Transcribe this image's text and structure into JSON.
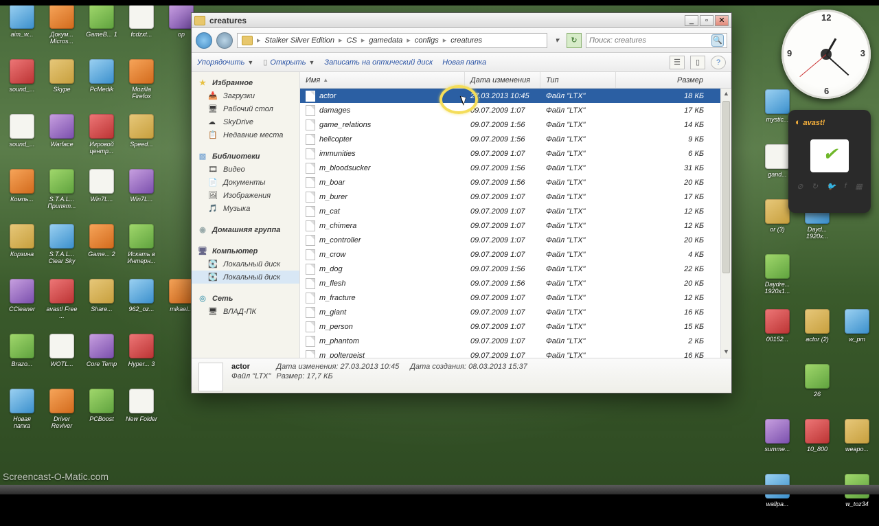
{
  "window": {
    "title": "creatures",
    "breadcrumbs": [
      "Stalker Silver Edition",
      "CS",
      "gamedata",
      "configs",
      "creatures"
    ],
    "search_placeholder": "Поиск: creatures",
    "toolbar": {
      "organize": "Упорядочить",
      "open": "Открыть",
      "burn": "Записать на оптический диск",
      "newfolder": "Новая папка"
    },
    "columns": {
      "name": "Имя",
      "date": "Дата изменения",
      "type": "Тип",
      "size": "Размер"
    },
    "files": [
      {
        "name": "actor",
        "date": "27.03.2013 10:45",
        "type": "Файл \"LTX\"",
        "size": "18 КБ",
        "sel": true
      },
      {
        "name": "damages",
        "date": "09.07.2009 1:07",
        "type": "Файл \"LTX\"",
        "size": "17 КБ"
      },
      {
        "name": "game_relations",
        "date": "09.07.2009 1:56",
        "type": "Файл \"LTX\"",
        "size": "14 КБ"
      },
      {
        "name": "helicopter",
        "date": "09.07.2009 1:56",
        "type": "Файл \"LTX\"",
        "size": "9 КБ"
      },
      {
        "name": "immunities",
        "date": "09.07.2009 1:07",
        "type": "Файл \"LTX\"",
        "size": "6 КБ"
      },
      {
        "name": "m_bloodsucker",
        "date": "09.07.2009 1:56",
        "type": "Файл \"LTX\"",
        "size": "31 КБ"
      },
      {
        "name": "m_boar",
        "date": "09.07.2009 1:56",
        "type": "Файл \"LTX\"",
        "size": "20 КБ"
      },
      {
        "name": "m_burer",
        "date": "09.07.2009 1:07",
        "type": "Файл \"LTX\"",
        "size": "17 КБ"
      },
      {
        "name": "m_cat",
        "date": "09.07.2009 1:07",
        "type": "Файл \"LTX\"",
        "size": "12 КБ"
      },
      {
        "name": "m_chimera",
        "date": "09.07.2009 1:07",
        "type": "Файл \"LTX\"",
        "size": "12 КБ"
      },
      {
        "name": "m_controller",
        "date": "09.07.2009 1:07",
        "type": "Файл \"LTX\"",
        "size": "20 КБ"
      },
      {
        "name": "m_crow",
        "date": "09.07.2009 1:07",
        "type": "Файл \"LTX\"",
        "size": "4 КБ"
      },
      {
        "name": "m_dog",
        "date": "09.07.2009 1:56",
        "type": "Файл \"LTX\"",
        "size": "22 КБ"
      },
      {
        "name": "m_flesh",
        "date": "09.07.2009 1:56",
        "type": "Файл \"LTX\"",
        "size": "20 КБ"
      },
      {
        "name": "m_fracture",
        "date": "09.07.2009 1:07",
        "type": "Файл \"LTX\"",
        "size": "12 КБ"
      },
      {
        "name": "m_giant",
        "date": "09.07.2009 1:07",
        "type": "Файл \"LTX\"",
        "size": "16 КБ"
      },
      {
        "name": "m_person",
        "date": "09.07.2009 1:07",
        "type": "Файл \"LTX\"",
        "size": "15 КБ"
      },
      {
        "name": "m_phantom",
        "date": "09.07.2009 1:07",
        "type": "Файл \"LTX\"",
        "size": "2 КБ"
      },
      {
        "name": "m_poltergeist",
        "date": "09.07.2009 1:07",
        "type": "Файл \"LTX\"",
        "size": "16 КБ"
      }
    ],
    "details": {
      "name": "actor",
      "type": "Файл \"LTX\"",
      "label_modified": "Дата изменения:",
      "modified": "27.03.2013 10:45",
      "label_size": "Размер:",
      "size": "17,7 КБ",
      "label_created": "Дата создания:",
      "created": "08.03.2013 15:37"
    },
    "sidebar": {
      "favorites": {
        "label": "Избранное",
        "items": [
          "Загрузки",
          "Рабочий стол",
          "SkyDrive",
          "Недавние места"
        ]
      },
      "libraries": {
        "label": "Библиотеки",
        "items": [
          "Видео",
          "Документы",
          "Изображения",
          "Музыка"
        ]
      },
      "homegroup": {
        "label": "Домашняя группа"
      },
      "computer": {
        "label": "Компьютер",
        "items": [
          "Локальный диск",
          "Локальный диск"
        ]
      },
      "network": {
        "label": "Сеть",
        "items": [
          "ВЛАД-ПК"
        ]
      }
    }
  },
  "avast": {
    "brand": "avast!"
  },
  "watermark": "Screencast-O-Matic.com",
  "desktop_left": [
    "aim_w...",
    "Докум... Micros...",
    "GameB... 1",
    "fcdzxt...",
    "ор",
    "sound_...",
    "Skype",
    "PcMedik",
    "Mozilla Firefox",
    "",
    "sound_...",
    "Warface",
    "Игровой центр...",
    "Speed...",
    "",
    "Компь...",
    "S.T.A.L... Припят...",
    "Win7L...",
    "Win7L...",
    "",
    "Корзина",
    "S.T.A.L... Clear Sky",
    "Game... 2",
    "Искать в Интерн...",
    "",
    "CCleaner",
    "avast! Free ...",
    "Share...",
    "962_oz...",
    "mikael...",
    "Brazo...",
    "WOTL...",
    "Core Temp",
    "Hyper... 3",
    "",
    "Новая папка",
    "Driver Reviver",
    "PCBoost",
    "New Folder",
    ""
  ],
  "desktop_right": [
    "mystic...",
    "",
    "",
    "gand...",
    "",
    "",
    "or (3)",
    "Dayd... 1920x...",
    "",
    "Daydre... 1920x1...",
    "",
    "",
    "00152...",
    "actor (2)",
    "w_pm",
    "",
    "26",
    "",
    "summe...",
    "10_800",
    "weapo...",
    "wallpa...",
    "",
    "w_toz34"
  ]
}
